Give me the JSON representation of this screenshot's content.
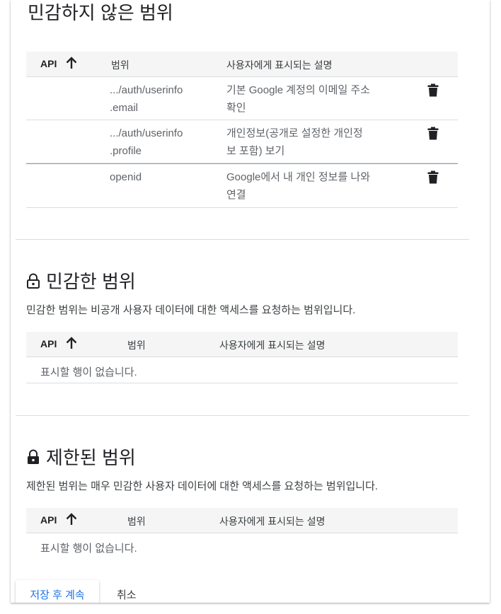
{
  "nonsensitive": {
    "title": "민감하지 않은 범위",
    "headers": {
      "api": "API",
      "scope": "범위",
      "desc": "사용자에게 표시되는 설명"
    },
    "rows": [
      {
        "scope1": ".../auth/userinfo",
        "scope2": ".email",
        "desc1": "기본 Google 계정의 이메일 주소",
        "desc2": "확인"
      },
      {
        "scope1": ".../auth/userinfo",
        "scope2": ".profile",
        "desc1": "개인정보(공개로 설정한 개인정",
        "desc2": "보 포함) 보기"
      },
      {
        "scope1": "openid",
        "scope2": "",
        "desc1": "Google에서 내 개인 정보를 나와",
        "desc2": "연결"
      }
    ]
  },
  "sensitive": {
    "title": "민감한 범위",
    "description": "민감한 범위는 비공개 사용자 데이터에 대한 액세스를 요청하는 범위입니다.",
    "headers": {
      "api": "API",
      "scope": "범위",
      "desc": "사용자에게 표시되는 설명"
    },
    "empty": "표시할 행이 없습니다."
  },
  "restricted": {
    "title": "제한된 범위",
    "description": "제한된 범위는 매우 민감한 사용자 데이터에 대한 액세스를 요청하는 범위입니다.",
    "headers": {
      "api": "API",
      "scope": "범위",
      "desc": "사용자에게 표시되는 설명"
    },
    "empty": "표시할 행이 없습니다."
  },
  "actions": {
    "save": "저장 후 계속",
    "cancel": "취소"
  },
  "colors": {
    "accent": "#1a73e8",
    "header_bg": "#f5f5f5",
    "border": "#dadce0"
  },
  "icons": {
    "sort": "arrow-up-icon",
    "delete": "trash-icon",
    "sensitive": "lock-open-icon",
    "restricted": "lock-icon"
  }
}
